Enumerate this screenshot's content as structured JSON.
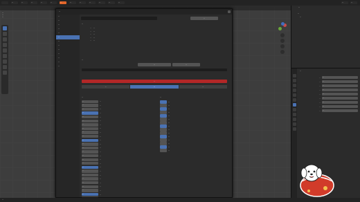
{
  "topbar": {
    "menus": [
      "--",
      "--",
      "--",
      "--",
      "--"
    ],
    "tabs": [
      "--",
      "--",
      "--",
      "--",
      "--",
      "--",
      "--"
    ],
    "active_tab_index": 0,
    "right_items": [
      "--",
      "--"
    ]
  },
  "viewport": {
    "info_lines": [
      "--",
      "--",
      "--"
    ]
  },
  "dialog": {
    "title": "--",
    "nav": [
      "--",
      "--",
      "--",
      "--",
      "--",
      "--",
      "--",
      "--",
      "--",
      "--",
      "--",
      "--",
      "--"
    ],
    "active_nav_index": 5,
    "header_line": "--",
    "info_rows": [
      {
        "label": "--",
        "value": "--"
      },
      {
        "label": "--",
        "value": "--"
      },
      {
        "label": "--",
        "value": "--"
      },
      {
        "label": "--",
        "value": "--"
      },
      {
        "label": "--",
        "value": "--"
      }
    ],
    "section_label": "--",
    "top_button": "--",
    "action_buttons": [
      "--",
      "--"
    ],
    "redbar_label": "--",
    "tabs": [
      "--",
      "--",
      "--"
    ],
    "active_tab_index": 1,
    "keymap_header": "--",
    "keymap": [
      {
        "key": "--",
        "desc": "--"
      },
      {
        "key": "--",
        "desc": "--"
      },
      {
        "key": "--",
        "desc": "--"
      },
      {
        "key": "--",
        "desc": "--"
      },
      {
        "key": "--",
        "desc": "--"
      },
      {
        "key": "--",
        "desc": "--"
      },
      {
        "key": "--",
        "desc": "--"
      },
      {
        "key": "--",
        "desc": "--"
      },
      {
        "key": "--",
        "desc": "--"
      },
      {
        "key": "--",
        "desc": "--"
      },
      {
        "key": "--",
        "desc": "--"
      },
      {
        "key": "--",
        "desc": "--"
      },
      {
        "key": "--",
        "desc": "--"
      },
      {
        "key": "--",
        "desc": "--"
      },
      {
        "key": "--",
        "desc": "--"
      },
      {
        "key": "--",
        "desc": "--"
      },
      {
        "key": "--",
        "desc": "--"
      },
      {
        "key": "--",
        "desc": "--"
      },
      {
        "key": "--",
        "desc": "--"
      },
      {
        "key": "--",
        "desc": "--"
      },
      {
        "key": "--",
        "desc": "--"
      },
      {
        "key": "--",
        "desc": "--"
      },
      {
        "key": "--",
        "desc": "--"
      },
      {
        "key": "--",
        "desc": "--"
      },
      {
        "key": "--",
        "desc": "--"
      },
      {
        "key": "--",
        "desc": "--"
      },
      {
        "key": "--",
        "desc": "--"
      }
    ],
    "options_header": "--",
    "options": [
      {
        "label": "--",
        "on": true
      },
      {
        "label": "--",
        "on": false
      },
      {
        "label": "--",
        "on": true
      },
      {
        "label": "--",
        "on": false
      },
      {
        "label": "--",
        "on": true
      },
      {
        "label": "--",
        "on": false
      },
      {
        "label": "--",
        "on": false
      },
      {
        "label": "--",
        "on": true
      },
      {
        "label": "--",
        "on": false
      },
      {
        "label": "--",
        "on": false
      },
      {
        "label": "--",
        "on": true
      },
      {
        "label": "--",
        "on": false
      },
      {
        "label": "--",
        "on": false
      },
      {
        "label": "--",
        "on": true
      },
      {
        "label": "--",
        "on": false
      }
    ],
    "footer_label": "--"
  },
  "outliner": {
    "title": "--",
    "items": [
      "--",
      "--"
    ]
  },
  "properties": {
    "title": "--",
    "rows": [
      {
        "label": "--",
        "value": "--"
      },
      {
        "label": "--",
        "value": "--"
      },
      {
        "label": "--",
        "value": "--"
      },
      {
        "label": "--",
        "value": "--"
      },
      {
        "label": "--",
        "value": "--"
      },
      {
        "label": "--",
        "value": "--"
      },
      {
        "label": "--",
        "value": "--"
      },
      {
        "label": "--",
        "value": "--"
      },
      {
        "label": "--",
        "value": "--"
      }
    ]
  },
  "statusbar": {
    "text": "--"
  },
  "colors": {
    "accent_blue": "#4a72b3",
    "accent_orange": "#e2662b",
    "danger_red": "#b32727",
    "sticker_red": "#d13b2a"
  }
}
